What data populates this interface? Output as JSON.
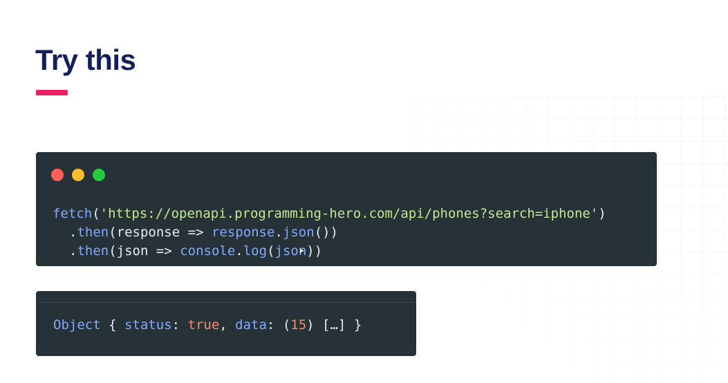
{
  "slide": {
    "title": "Try this"
  },
  "colors": {
    "title": "#13205a",
    "accent_underline": "#e91e63",
    "code_bg": "#263238",
    "dot_red": "#ff5f56",
    "dot_yellow": "#ffbd2e",
    "dot_green": "#27c93f"
  },
  "code_window": {
    "window_buttons": [
      "close-dot",
      "minimize-dot",
      "maximize-dot"
    ],
    "lines": [
      {
        "fn": "fetch",
        "open": "(",
        "url": "'https://openapi.programming-hero.com/api/phones?search=iphone'",
        "close": ")"
      },
      {
        "dot": ".",
        "method": "then",
        "open": "(",
        "param": "response",
        "arrow": " => ",
        "call_obj": "response",
        "call_dot": ".",
        "call_fn": "json",
        "call_parens": "()",
        "close": ")"
      },
      {
        "dot": ".",
        "method": "then",
        "open": "(",
        "param": "json",
        "arrow": " => ",
        "call_obj": "console",
        "call_dot": ".",
        "call_fn": "log",
        "call_open": "(",
        "call_arg": "json",
        "close": "))"
      }
    ]
  },
  "console_output": {
    "type_label": "Object",
    "open_brace": " { ",
    "key1": "status",
    "colon1": ": ",
    "val1": "true",
    "sep": ", ",
    "key2": "data",
    "colon2": ": ",
    "paren_open": "(",
    "count": "15",
    "paren_close": ") ",
    "collapsed": "[…]",
    "close_brace": " }"
  }
}
